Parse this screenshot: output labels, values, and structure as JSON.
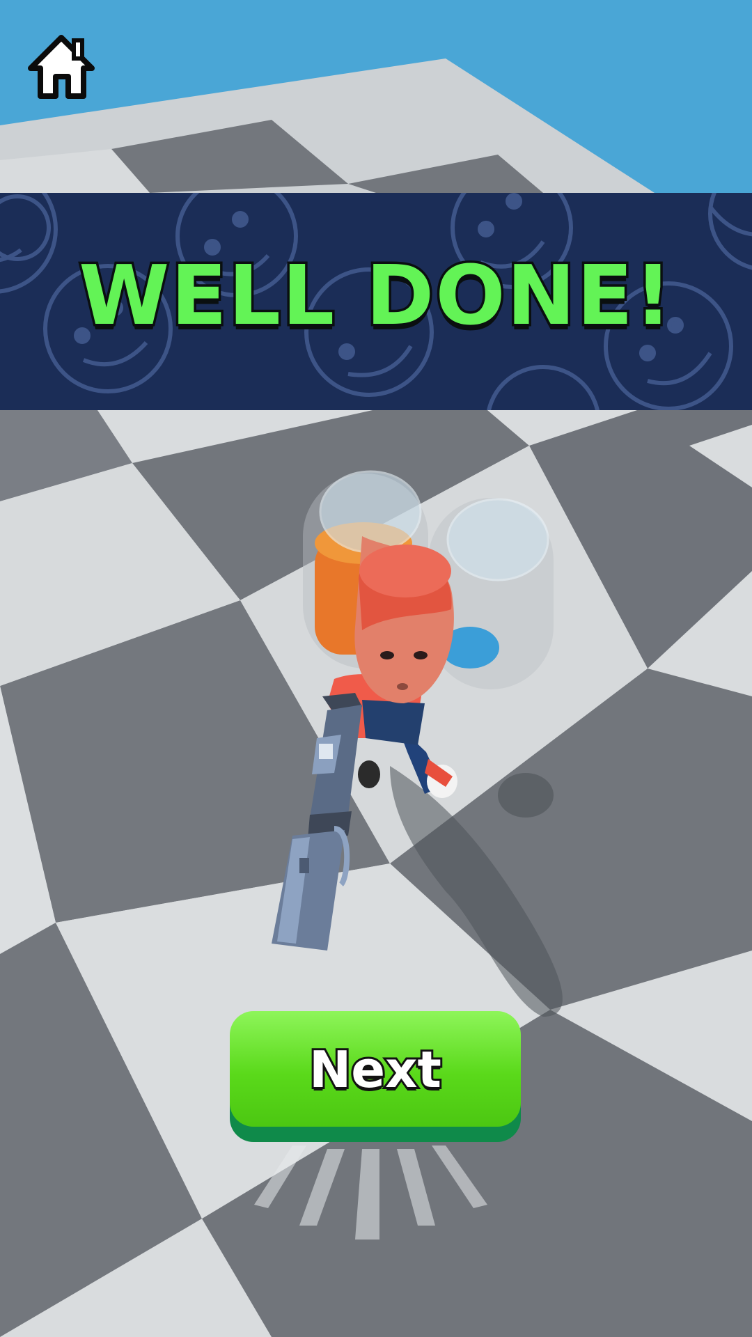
{
  "header": {
    "home_icon": "home-icon"
  },
  "banner": {
    "title": "WELL DONE!",
    "pattern_icon": "smiley-face-icon"
  },
  "actions": {
    "next_label": "Next"
  },
  "colors": {
    "sky": "#4aa6d6",
    "banner_bg": "#1b2d57",
    "title_fill": "#63f356",
    "button_green": "#5ad91a",
    "button_shadow": "#0f8a4a",
    "floor_light": "#dde0e2",
    "floor_dark": "#6e7279"
  }
}
